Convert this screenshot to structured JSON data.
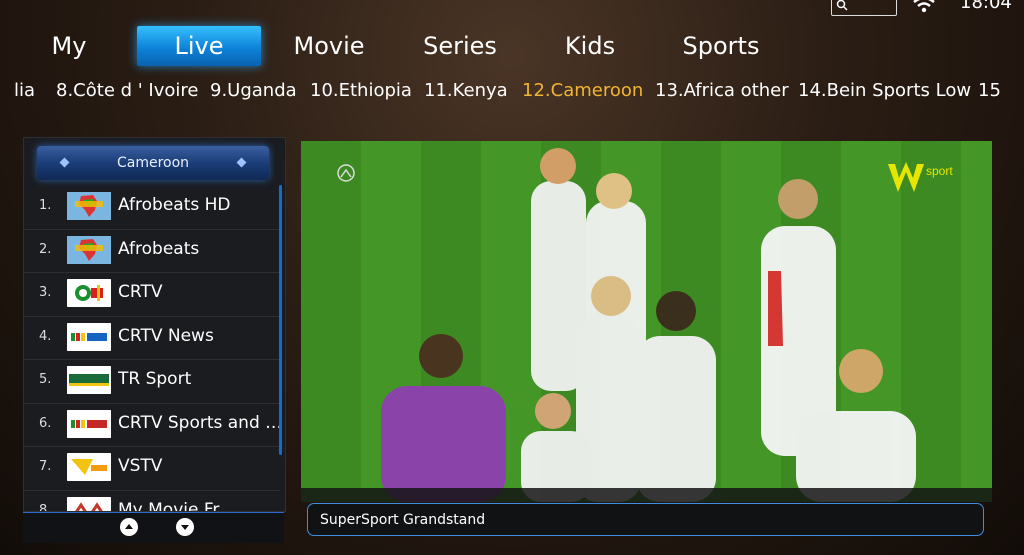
{
  "status": {
    "time": "18:04"
  },
  "tabs": [
    {
      "label": "My",
      "active": false
    },
    {
      "label": "Live",
      "active": true
    },
    {
      "label": "Movie",
      "active": false
    },
    {
      "label": "Series",
      "active": false
    },
    {
      "label": "Kids",
      "active": false
    },
    {
      "label": "Sports",
      "active": false
    }
  ],
  "categories": [
    {
      "label": "lia",
      "active": false
    },
    {
      "label": "8.Côte d ' Ivoire",
      "active": false
    },
    {
      "label": "9.Uganda",
      "active": false
    },
    {
      "label": "10.Ethiopia",
      "active": false
    },
    {
      "label": "11.Kenya",
      "active": false
    },
    {
      "label": "12.Cameroon",
      "active": true
    },
    {
      "label": "13.Africa other",
      "active": false
    },
    {
      "label": "14.Bein Sports Low",
      "active": false
    },
    {
      "label": "15",
      "active": false
    }
  ],
  "panel": {
    "title": "Cameroon",
    "channels": [
      {
        "num": "1.",
        "name": "Afrobeats HD",
        "logo": "afrobeats-logo"
      },
      {
        "num": "2.",
        "name": "Afrobeats",
        "logo": "afrobeats-logo"
      },
      {
        "num": "3.",
        "name": "CRTV",
        "logo": "crtv-logo"
      },
      {
        "num": "4.",
        "name": "CRTV News",
        "logo": "crtv-news-logo"
      },
      {
        "num": "5.",
        "name": "TR Sport",
        "logo": "tr-sport-logo"
      },
      {
        "num": "6.",
        "name": "CRTV Sports and E..",
        "logo": "crtv-sports-logo"
      },
      {
        "num": "7.",
        "name": "VSTV",
        "logo": "vstv-logo"
      },
      {
        "num": "8.",
        "name": "My Movie Fr",
        "logo": "my-movie-logo"
      }
    ]
  },
  "player": {
    "now_playing": "SuperSport Grandstand",
    "brand": "sport"
  },
  "colors": {
    "accent": "#1a9bf0",
    "active_category": "#f2b533"
  }
}
